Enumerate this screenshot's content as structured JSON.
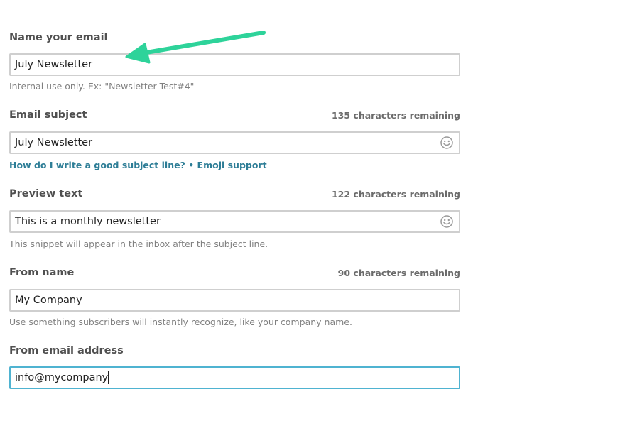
{
  "fields": {
    "name": {
      "label": "Name your email",
      "value": "July Newsletter",
      "help": "Internal use only. Ex: \"Newsletter Test#4\""
    },
    "subject": {
      "label": "Email subject",
      "counter": "135 characters remaining",
      "value": "July Newsletter",
      "link_guide": "How do I write a good subject line?",
      "separator": " • ",
      "link_emoji": "Emoji support"
    },
    "preview": {
      "label": "Preview text",
      "counter": "122 characters remaining",
      "value": "This is a monthly newsletter",
      "help": "This snippet will appear in the inbox after the subject line."
    },
    "from_name": {
      "label": "From name",
      "counter": "90 characters remaining",
      "value": "My Company",
      "help": "Use something subscribers will instantly recognize, like your company name."
    },
    "from_email": {
      "label": "From email address",
      "value": "info@mycompany"
    }
  },
  "icons": {
    "emoji": "smiley-face-icon",
    "annotation": "arrow-pointer-icon"
  },
  "colors": {
    "annotation_arrow": "#2ed39a",
    "focus_border": "#4fb3d1",
    "link": "#2d7d96"
  }
}
